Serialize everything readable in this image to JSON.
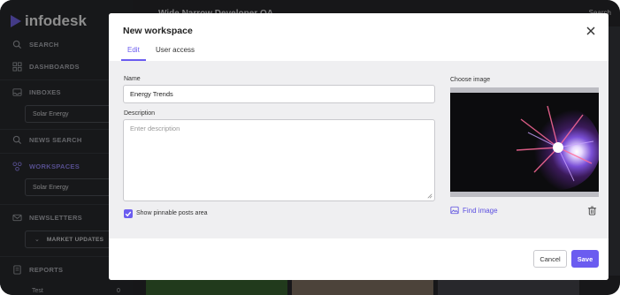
{
  "app": {
    "brand": "infodesk"
  },
  "sidebar": {
    "items": [
      {
        "label": "SEARCH",
        "icon": "search-icon"
      },
      {
        "label": "DASHBOARDS",
        "icon": "dashboard-icon"
      },
      {
        "label": "INBOXES",
        "icon": "inbox-icon"
      },
      {
        "label": "NEWS SEARCH",
        "icon": "search-icon"
      },
      {
        "label": "WORKSPACES",
        "icon": "workspaces-icon"
      },
      {
        "label": "NEWSLETTERS",
        "icon": "mail-icon"
      },
      {
        "label": "REPORTS",
        "icon": "report-icon"
      }
    ],
    "inbox_selected": "Solar Energy",
    "workspace_selected": "Solar Energy",
    "newsletters_tree": "MARKET UPDATES",
    "report_item": "Test",
    "report_count": "0"
  },
  "background": {
    "topbar_title": "Wide Narrow Developer QA",
    "topbar_right": "Search"
  },
  "modal": {
    "title": "New workspace",
    "tabs": [
      {
        "label": "Edit",
        "active": true
      },
      {
        "label": "User access",
        "active": false
      }
    ],
    "name_label": "Name",
    "name_value": "Energy Trends",
    "description_label": "Description",
    "description_placeholder": "Enter description",
    "pinnable_label": "Show pinnable posts area",
    "pinnable_checked": true,
    "choose_image_label": "Choose image",
    "find_image_label": "Find image",
    "cancel_label": "Cancel",
    "save_label": "Save"
  },
  "colors": {
    "accent": "#6b5cf0",
    "sidebar_bg": "#2b2d31",
    "modal_body_bg": "#efeff1"
  }
}
